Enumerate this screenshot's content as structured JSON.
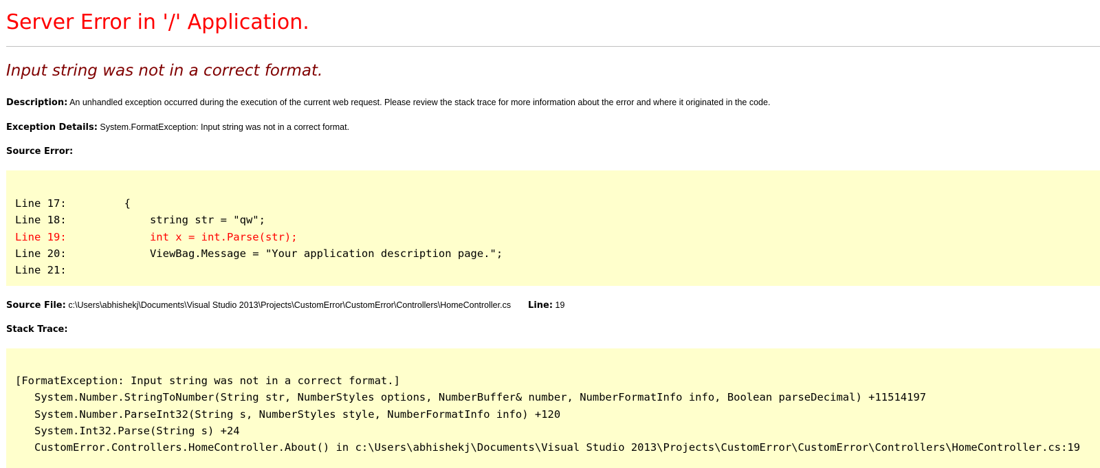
{
  "page": {
    "title": "Server Error in '/' Application.",
    "subtitle": "Input string was not in a correct format."
  },
  "description": {
    "label": "Description:",
    "text": "An unhandled exception occurred during the execution of the current web request. Please review the stack trace for more information about the error and where it originated in the code."
  },
  "exception": {
    "label": "Exception Details:",
    "text": "System.FormatException: Input string was not in a correct format."
  },
  "source_error": {
    "label": "Source Error:",
    "lines": [
      "Line 17:         {",
      "Line 18:             string str = \"qw\";",
      "Line 19:             int x = int.Parse(str);",
      "Line 20:             ViewBag.Message = \"Your application description page.\";",
      "Line 21:"
    ],
    "highlight_line": "Line 19",
    "highlight_color": "#ff0000",
    "background_color": "#ffffcc"
  },
  "source_file": {
    "label": "Source File:",
    "path": "c:\\Users\\abhishekj\\Documents\\Visual Studio 2013\\Projects\\CustomError\\CustomError\\Controllers\\HomeController.cs",
    "line_label": "Line:",
    "line_number": "19"
  },
  "stack_trace": {
    "label": "Stack Trace:",
    "lines": [
      "[FormatException: Input string was not in a correct format.]",
      "   System.Number.StringToNumber(String str, NumberStyles options, NumberBuffer& number, NumberFormatInfo info, Boolean parseDecimal) +11514197",
      "   System.Number.ParseInt32(String s, NumberStyles style, NumberFormatInfo info) +120",
      "   System.Int32.Parse(String s) +24",
      "   CustomError.Controllers.HomeController.About() in c:\\Users\\abhishekj\\Documents\\Visual Studio 2013\\Projects\\CustomError\\CustomError\\Controllers\\HomeController.cs:19"
    ]
  },
  "colors": {
    "title": "#ff0000",
    "subtitle": "#800000",
    "code_background": "#ffffcc"
  }
}
